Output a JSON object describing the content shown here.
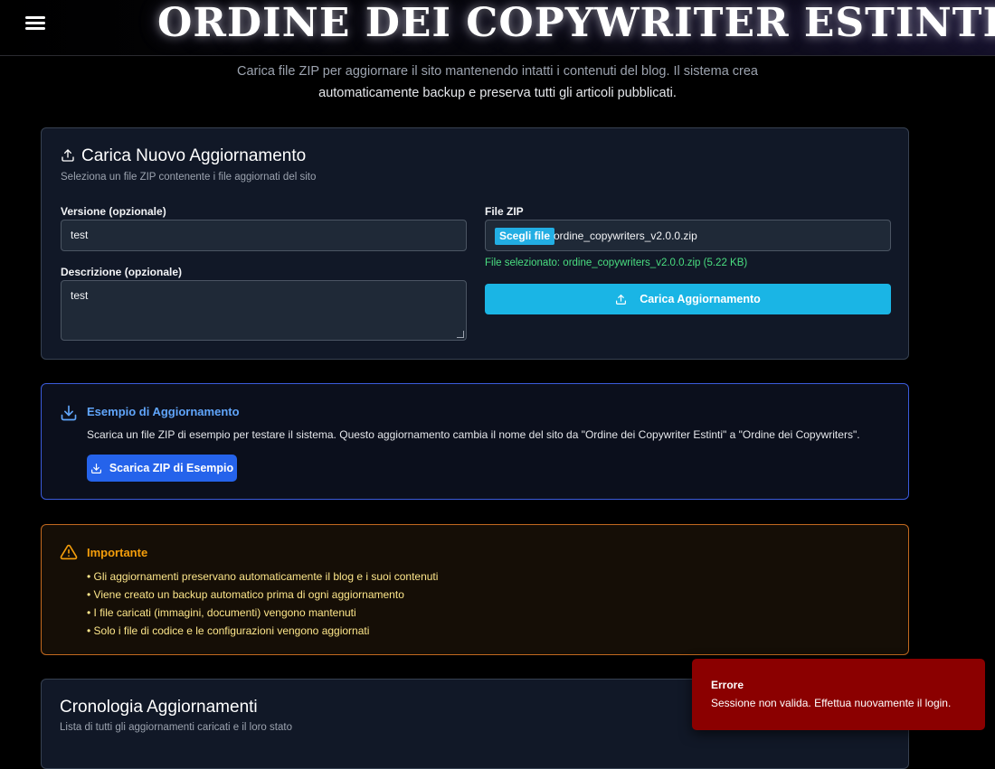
{
  "header": {
    "title": "Ordine dei Copywriter Estinti"
  },
  "intro": {
    "line1": "Carica file ZIP per aggiornare il sito mantenendo intatti i contenuti del blog. Il sistema crea",
    "line2": "automaticamente backup e preserva tutti gli articoli pubblicati."
  },
  "upload": {
    "title": "Carica Nuovo Aggiornamento",
    "subtitle": "Seleziona un file ZIP contenente i file aggiornati del sito",
    "version_label": "Versione (opzionale)",
    "version_value": "test",
    "description_label": "Descrizione (opzionale)",
    "description_value": "test",
    "file_label": "File ZIP",
    "file_button": "Scegli file",
    "file_name": "ordine_copywriters_v2.0.0.zip",
    "file_status": "File selezionato: ordine_copywriters_v2.0.0.zip (5.22 KB)",
    "submit_label": "Carica Aggiornamento",
    "icon": "upload-icon"
  },
  "example": {
    "title": "Esempio di Aggiornamento",
    "text": "Scarica un file ZIP di esempio per testare il sistema. Questo aggiornamento cambia il nome del sito da \"Ordine dei Copywriter Estinti\" a \"Ordine dei Copywriters\".",
    "button_label": "Scarica ZIP di Esempio",
    "icon": "download-icon"
  },
  "important": {
    "title": "Importante",
    "items": [
      "• Gli aggiornamenti preservano automaticamente il blog e i suoi contenuti",
      "• Viene creato un backup automatico prima di ogni aggiornamento",
      "• I file caricati (immagini, documenti) vengono mantenuti",
      "• Solo i file di codice e le configurazioni vengono aggiornati"
    ],
    "icon": "warning-icon"
  },
  "history": {
    "title": "Cronologia Aggiornamenti",
    "subtitle": "Lista di tutti gli aggiornamenti caricati e il loro stato"
  },
  "toast": {
    "title": "Errore",
    "message": "Sessione non valida. Effettua nuovamente il login."
  },
  "colors": {
    "accent": "#1ab5e5",
    "link_blue": "#60a5fa",
    "button_blue": "#2563eb",
    "warning": "#f59e0b",
    "success": "#4ade80",
    "error_bg": "#8b0000"
  }
}
